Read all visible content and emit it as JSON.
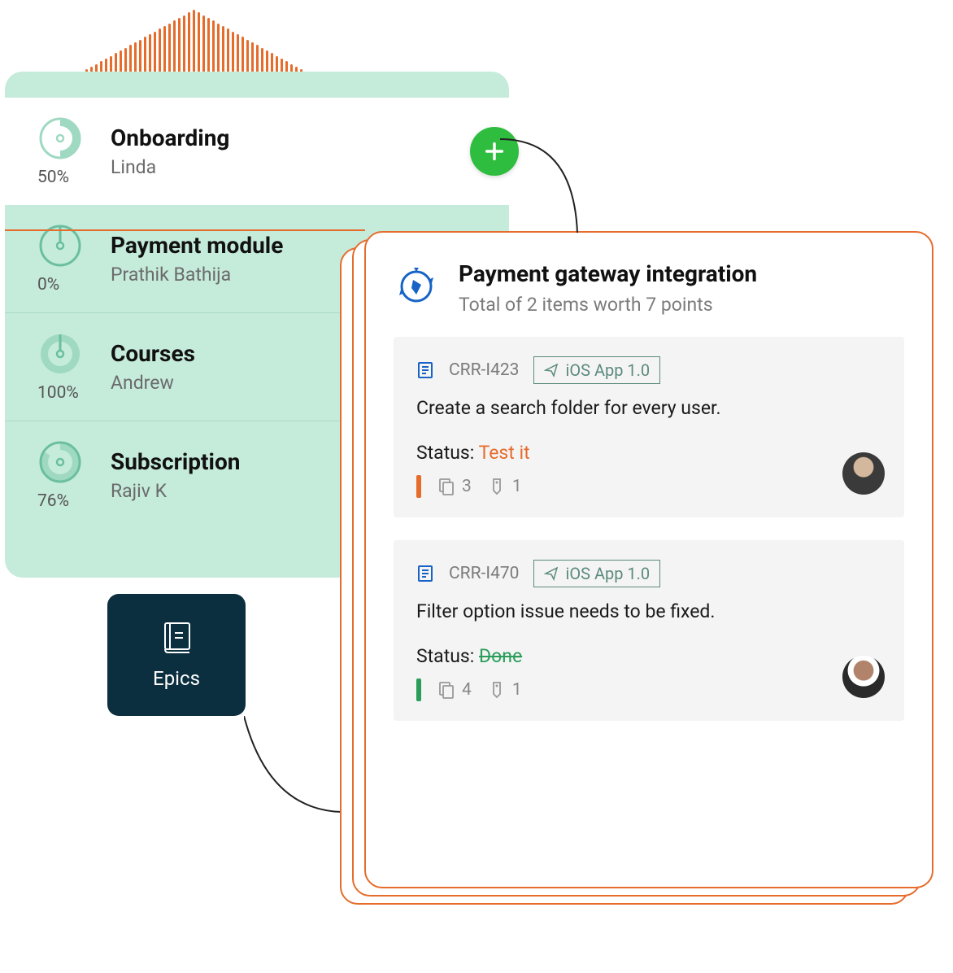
{
  "epics_label": "Epics",
  "epics": [
    {
      "title": "Onboarding",
      "owner": "Linda",
      "pct": "50%",
      "progress": 50,
      "selected": true
    },
    {
      "title": "Payment module",
      "owner": "Prathik Bathija",
      "pct": "0%",
      "progress": 0
    },
    {
      "title": "Courses",
      "owner": "Andrew",
      "pct": "100%",
      "progress": 100
    },
    {
      "title": "Subscription",
      "owner": "Rajiv K",
      "pct": "76%",
      "progress": 76
    }
  ],
  "detail": {
    "title": "Payment gateway integration",
    "subtitle": "Total of 2 items worth 7 points",
    "items": [
      {
        "id": "CRR-I423",
        "release": "iOS App 1.0",
        "desc": "Create a search folder for every user.",
        "status_label": "Status: ",
        "status_value": "Test it",
        "status_kind": "testit",
        "prio": "orange",
        "count_a": "3",
        "count_b": "1"
      },
      {
        "id": "CRR-I470",
        "release": "iOS App 1.0",
        "desc": "Filter option issue needs to be fixed.",
        "status_label": "Status: ",
        "status_value": "Done",
        "status_kind": "done",
        "prio": "green",
        "count_a": "4",
        "count_b": "1"
      }
    ]
  }
}
